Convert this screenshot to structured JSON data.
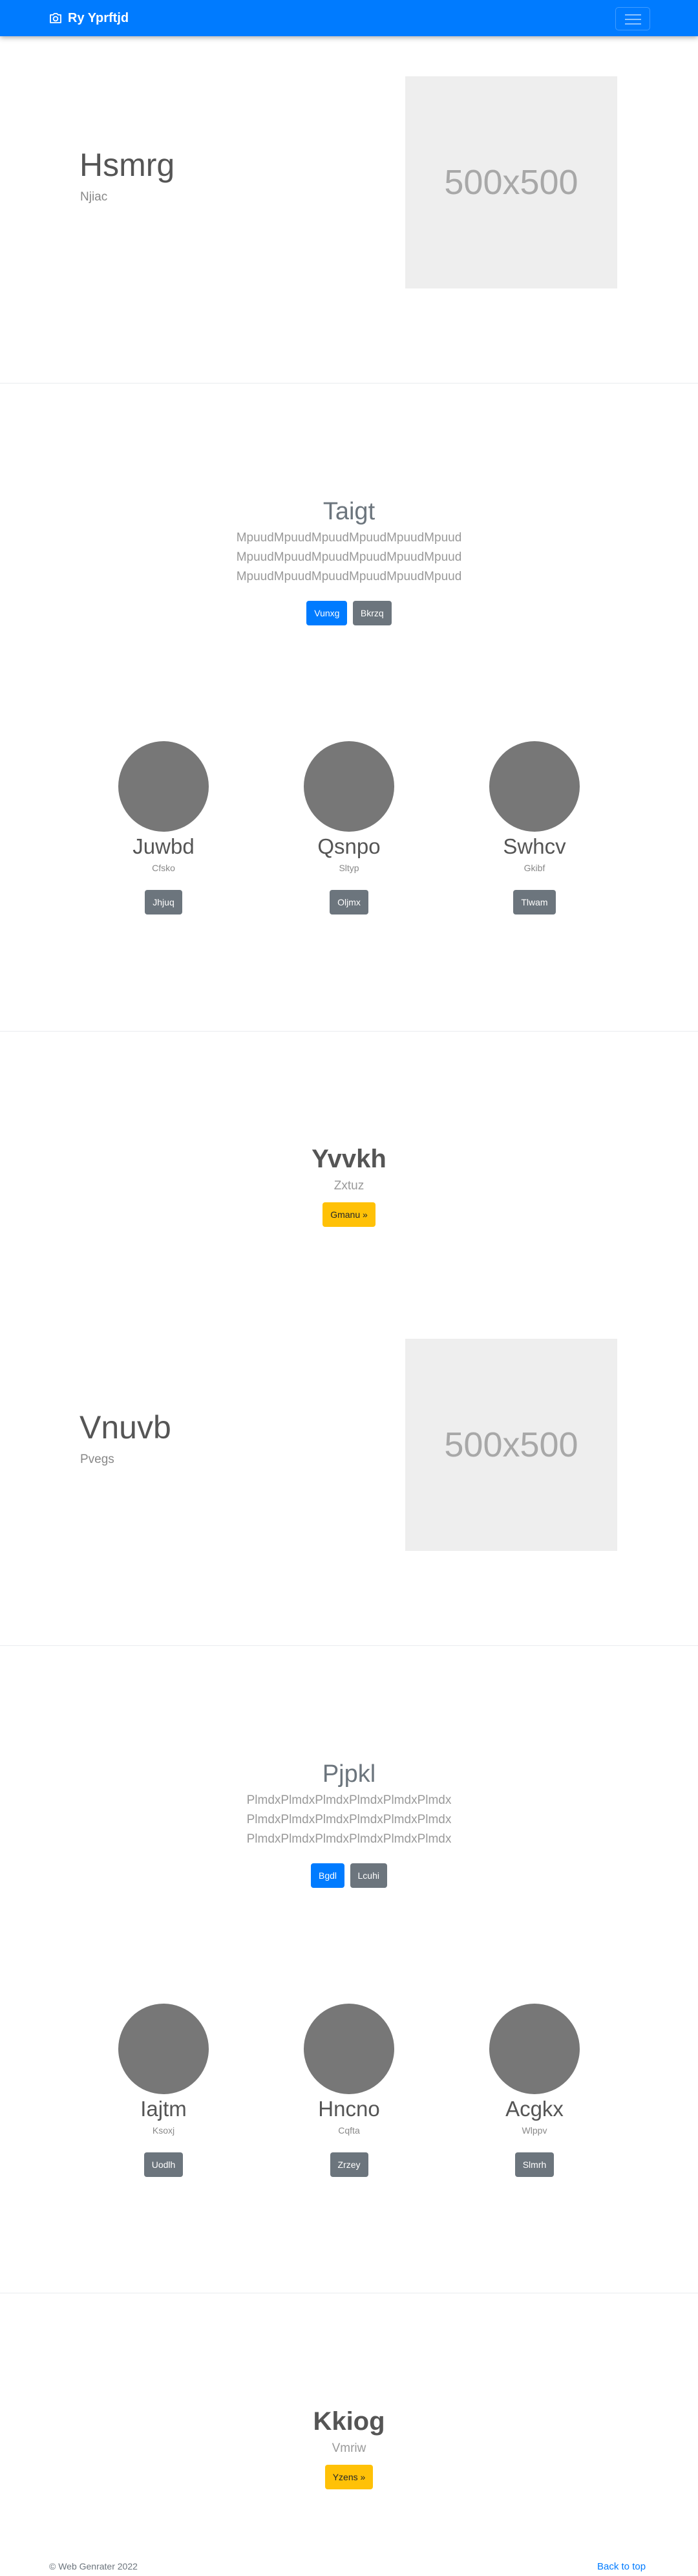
{
  "navbar": {
    "brand": "Ry Yprftjd",
    "brand_icon": "camera-icon",
    "color": "#007bff"
  },
  "section1": {
    "title": "Hsmrg",
    "subtitle": "Njiac",
    "image_placeholder": "500x500"
  },
  "section2": {
    "title": "Taigt",
    "paragraph_lines": [
      "MpuudMpuudMpuudMpuudMpuudMpuud",
      "MpuudMpuudMpuudMpuudMpuudMpuud",
      "MpuudMpuudMpuudMpuudMpuudMpuud"
    ],
    "primary_button": "Vunxg",
    "secondary_button": "Bkrzq",
    "members": [
      {
        "name": "Juwbd",
        "role": "Cfsko",
        "button": "Jhjuq"
      },
      {
        "name": "Qsnpo",
        "role": "Sltyp",
        "button": "Oljmx"
      },
      {
        "name": "Swhcv",
        "role": "Gkibf",
        "button": "Tlwam"
      }
    ]
  },
  "section3": {
    "title": "Yvvkh",
    "subtitle": "Zxtuz",
    "button": "Gmanu »"
  },
  "section4": {
    "title": "Vnuvb",
    "subtitle": "Pvegs",
    "image_placeholder": "500x500"
  },
  "section5": {
    "title": "Pjpkl",
    "paragraph_lines": [
      "PlmdxPlmdxPlmdxPlmdxPlmdxPlmdx",
      "PlmdxPlmdxPlmdxPlmdxPlmdxPlmdx",
      "PlmdxPlmdxPlmdxPlmdxPlmdxPlmdx"
    ],
    "primary_button": "Bgdl",
    "secondary_button": "Lcuhi",
    "members": [
      {
        "name": "Iajtm",
        "role": "Ksoxj",
        "button": "Uodlh"
      },
      {
        "name": "Hncno",
        "role": "Cqfta",
        "button": "Zrzey"
      },
      {
        "name": "Acgkx",
        "role": "Wlppv",
        "button": "Slmrh"
      }
    ]
  },
  "section6": {
    "title": "Kkiog",
    "subtitle": "Vmriw",
    "button": "Yzens »"
  },
  "footer": {
    "copyright": "© Web Genrater 2022",
    "back_to_top": "Back to top"
  }
}
